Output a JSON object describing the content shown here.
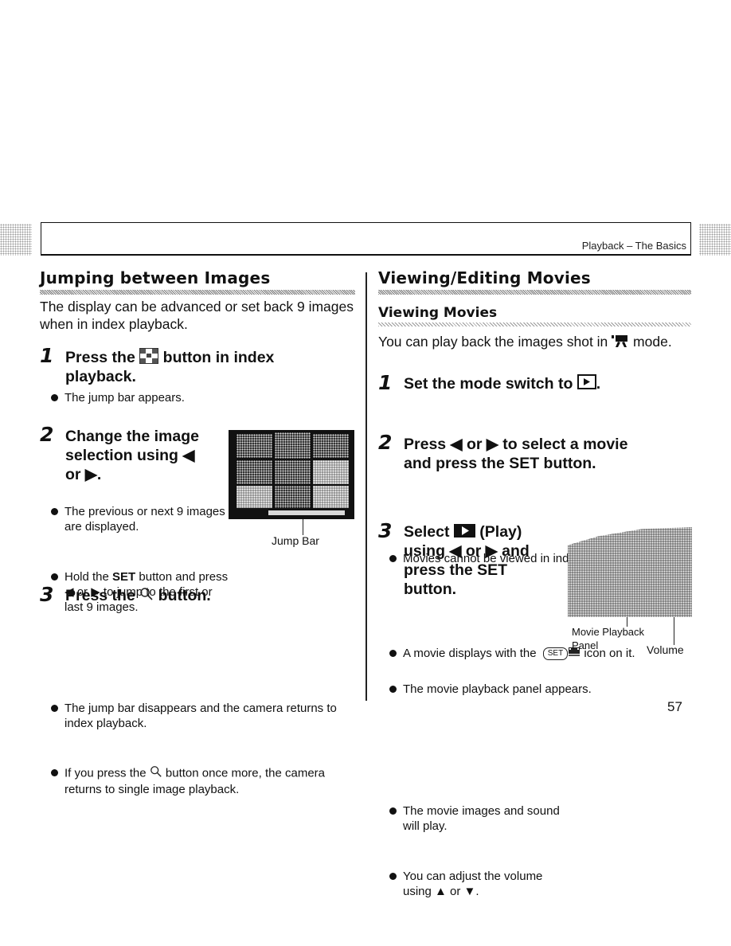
{
  "header": {
    "section_title": "Playback – The Basics"
  },
  "left_column": {
    "heading": "Jumping between Images",
    "intro": "The display can be advanced or set back 9 images when in index playback.",
    "steps": [
      {
        "number": "1",
        "title_before_icon": "Press the",
        "title_icon": "jump-button-icon",
        "title_after_icon": "button in index",
        "title_line2": "playback.",
        "bullets": [
          "The jump bar appears."
        ]
      },
      {
        "number": "2",
        "title_line1": "Change the image",
        "title_line2": "selection using ◀",
        "title_line3": "or ▶.",
        "bullets": [
          "The previous or next 9 images are displayed.",
          {
            "before_bold": "Hold the ",
            "bold": "SET",
            "after_bold": " button and press ◀ or ▶ to jump to the first or last 9 images."
          }
        ],
        "figure_caption": "Jump Bar"
      },
      {
        "number": "3",
        "title_before_icon": "Press the",
        "title_icon": "magnifier-icon",
        "title_after_icon": "button.",
        "bullets": [
          "The jump bar disappears and the camera returns to index playback.",
          {
            "before_icon": "If you press the",
            "icon": "magnifier-icon",
            "after_icon": "button once more, the camera returns to single image playback."
          }
        ]
      }
    ]
  },
  "right_column": {
    "heading": "Viewing/Editing Movies",
    "subheading": "Viewing Movies",
    "intro_before_icon": "You can play back the images shot in",
    "intro_icon": "movie-mode-icon",
    "intro_after_icon": "mode.",
    "steps": [
      {
        "number": "1",
        "title_before_icon": "Set the mode switch to",
        "title_icon": "playback-mode-icon",
        "title_after_icon": ".",
        "bullets": [
          "Movies cannot be viewed in index playback mode."
        ]
      },
      {
        "number": "2",
        "title_line1": "Press ◀ or ▶ to select a movie",
        "title_line2": "and press the SET button.",
        "bullets": [
          {
            "before_icon": "A movie displays with the",
            "icon": "set-movie-icon",
            "icon_text": "SET",
            "after_icon": "icon on it."
          },
          "The movie playback panel appears."
        ]
      },
      {
        "number": "3",
        "title_line1_before_icon": "Select",
        "title_icon": "play-icon",
        "title_line1_after_icon": "(Play)",
        "title_line2": "using ◀ or ▶ and",
        "title_line3": "press the SET",
        "title_line4": "button.",
        "bullets": [
          "The movie images and sound will play.",
          "You can adjust the volume using ▲ or ▼."
        ],
        "figure_labels": {
          "panel": "Movie Playback Panel",
          "panel_line1": "Movie Playback",
          "panel_line2": "Panel",
          "volume": "Volume"
        }
      }
    ]
  },
  "footer": {
    "page_number": "57"
  }
}
